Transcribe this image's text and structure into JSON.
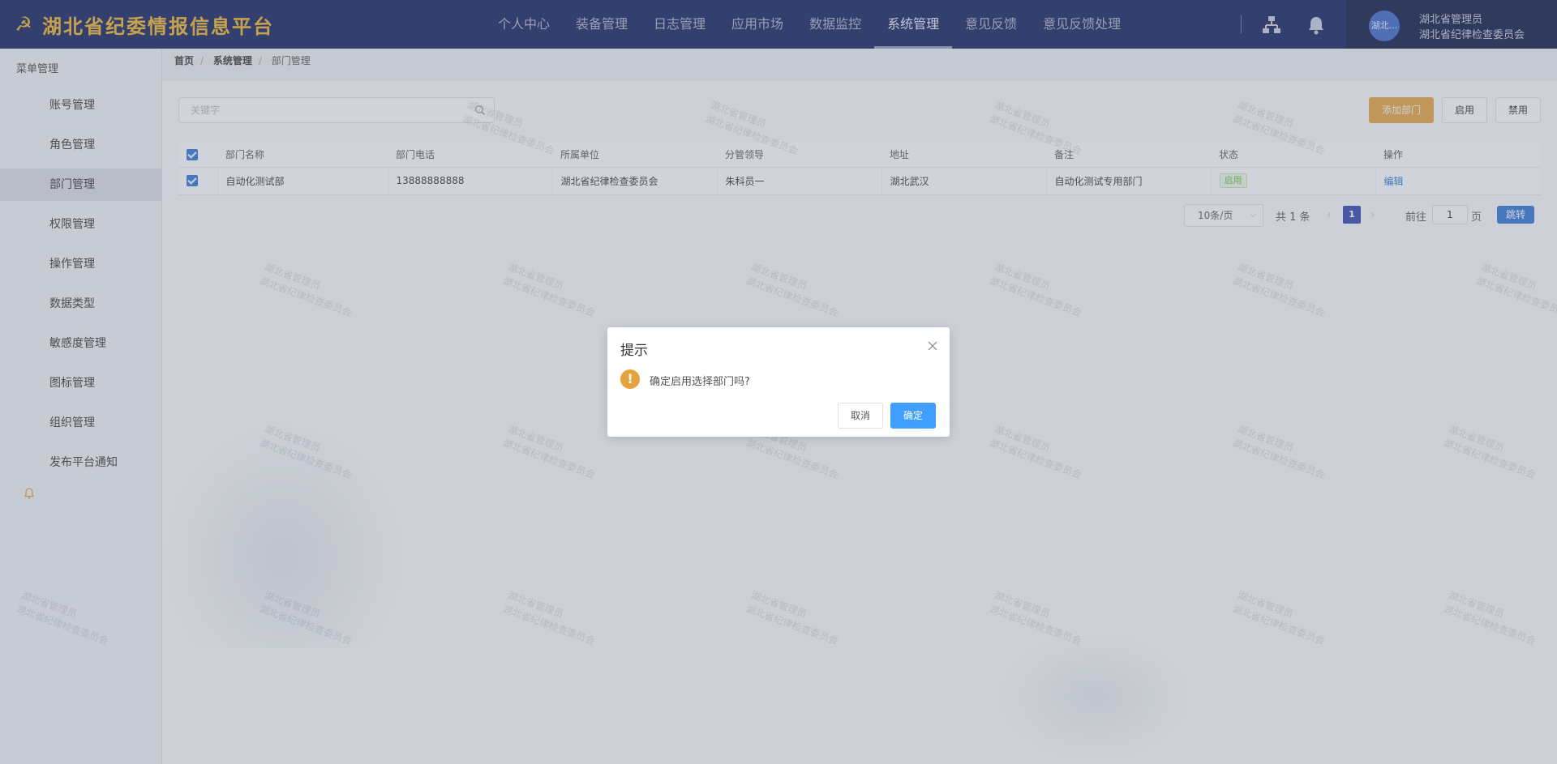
{
  "app": {
    "title": "湖北省纪委情报信息平台",
    "emblem": "☭"
  },
  "nav": {
    "items": [
      "个人中心",
      "装备管理",
      "日志管理",
      "应用市场",
      "数据监控",
      "系统管理",
      "意见反馈",
      "意见反馈处理"
    ],
    "active": "系统管理"
  },
  "user": {
    "avatar_text": "湖北...",
    "name": "湖北省管理员",
    "org": "湖北省纪律检查委员会"
  },
  "sidebar": {
    "title": "菜单管理",
    "items": [
      "账号管理",
      "角色管理",
      "部门管理",
      "权限管理",
      "操作管理",
      "数据类型",
      "敏感度管理",
      "图标管理",
      "组织管理",
      "发布平台通知"
    ],
    "active": "部门管理"
  },
  "breadcrumb": [
    "首页",
    "系统管理",
    "部门管理"
  ],
  "search": {
    "placeholder": "关键字",
    "value": ""
  },
  "toolbar": {
    "add_label": "添加部门",
    "enable_label": "启用",
    "disable_label": "禁用"
  },
  "table": {
    "headers": [
      "部门名称",
      "部门电话",
      "所属单位",
      "分管领导",
      "地址",
      "备注",
      "状态",
      "操作"
    ],
    "rows": [
      [
        "自动化测试部",
        "13888888888",
        "湖北省纪律检查委员会",
        "朱科员一",
        "湖北武汉",
        "自动化测试专用部门",
        "启用",
        "编辑"
      ]
    ]
  },
  "pagination": {
    "page_size": "10条/页",
    "total": "共 1 条",
    "current": "1",
    "goto_label": "前往",
    "goto_value": "1",
    "page_label": "页",
    "jump_label": "跳转"
  },
  "watermark": [
    "湖北省管理员",
    "湖北省纪律检查委员会"
  ],
  "dialog": {
    "title": "提示",
    "message": "确定启用选择部门吗?",
    "cancel_label": "取消",
    "ok_label": "确定",
    "warn_glyph": "!"
  },
  "colors": {
    "nav_bg": "#0f1d5c",
    "brand_gold": "#f0b429",
    "primary": "#409eff",
    "warning": "#e6a23c",
    "success": "#67c23a"
  }
}
